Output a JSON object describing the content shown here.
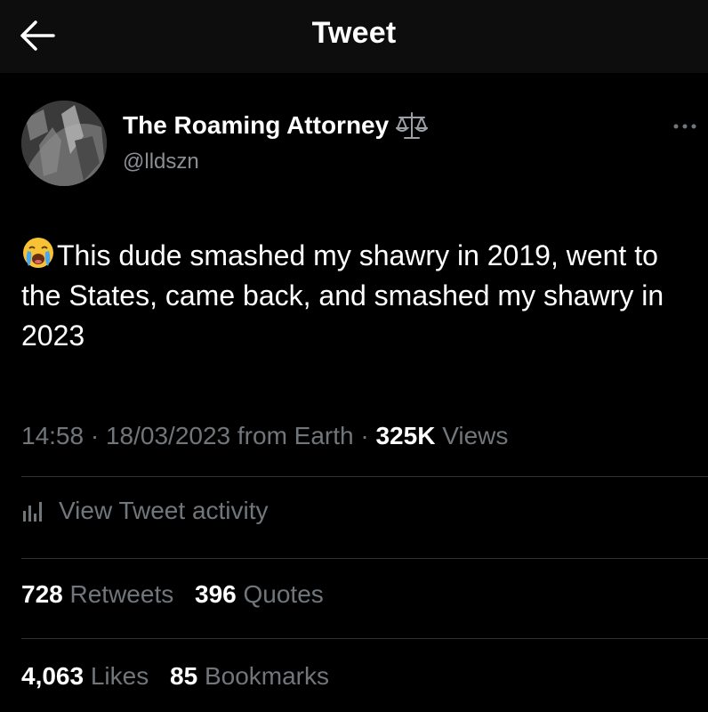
{
  "header": {
    "title": "Tweet",
    "back_icon": "arrow-left-icon"
  },
  "author": {
    "name": "The Roaming Attorney",
    "handle": "@lldszn",
    "badge_icon": "scales-icon"
  },
  "tweet": {
    "emoji": "loudly-crying-face",
    "text": "This dude smashed my shawry in 2019, went to the States, came back, and smashed my shawry in 2023"
  },
  "meta": {
    "time": "14:58",
    "date": "18/03/2023",
    "source": "from Earth",
    "views_count": "325K",
    "views_label": "Views",
    "separator": " · "
  },
  "activity": {
    "label": "View Tweet activity"
  },
  "stats": {
    "retweets_count": "728",
    "retweets_label": "Retweets",
    "quotes_count": "396",
    "quotes_label": "Quotes",
    "likes_count": "4,063",
    "likes_label": "Likes",
    "bookmarks_count": "85",
    "bookmarks_label": "Bookmarks"
  },
  "colors": {
    "background": "#000000",
    "header_bg": "#0d0d0d",
    "primary_text": "#ffffff",
    "secondary_text": "#71767b",
    "divider": "#2f3336"
  }
}
